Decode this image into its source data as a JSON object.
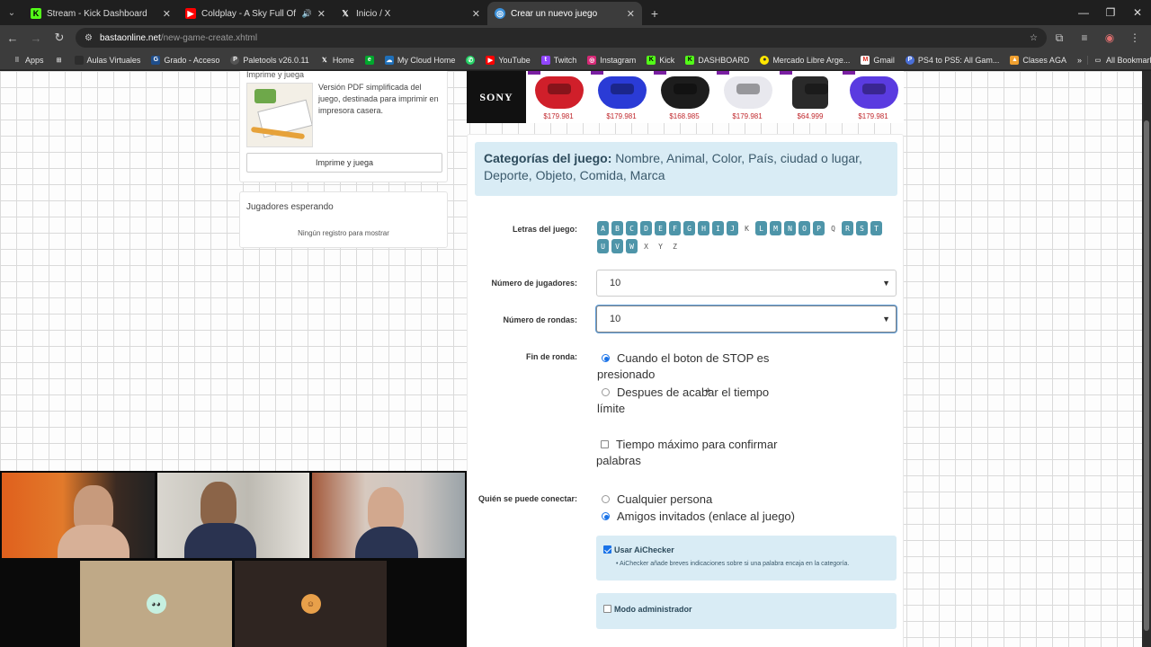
{
  "browser": {
    "tabs": [
      {
        "title": "Stream - Kick Dashboard",
        "icon": "kick-icon"
      },
      {
        "title": "Coldplay - A Sky Full Of Sta",
        "icon": "youtube-icon"
      },
      {
        "title": "Inicio / X",
        "icon": "x-icon"
      },
      {
        "title": "Crear un nuevo juego",
        "icon": "globe-icon",
        "active": true
      }
    ],
    "url_domain": "bastaonline.net",
    "url_path": "/new-game-create.xhtml",
    "bookmarks": [
      {
        "label": "Apps",
        "icon": "apps-grid-icon"
      },
      {
        "label": "",
        "icon": "tab-groups-icon"
      },
      {
        "label": "Aulas Virtuales",
        "icon": "aulas-icon"
      },
      {
        "label": "Grado - Acceso",
        "icon": "grado-icon"
      },
      {
        "label": "Paletools v26.0.11",
        "icon": "paletools-icon"
      },
      {
        "label": "Home",
        "icon": "x-icon"
      },
      {
        "label": "",
        "icon": "evernote-icon"
      },
      {
        "label": "My Cloud Home",
        "icon": "cloud-icon"
      },
      {
        "label": "",
        "icon": "whatsapp-icon"
      },
      {
        "label": "YouTube",
        "icon": "youtube-icon"
      },
      {
        "label": "Twitch",
        "icon": "twitch-icon"
      },
      {
        "label": "Instagram",
        "icon": "instagram-icon"
      },
      {
        "label": "Kick",
        "icon": "kick-icon"
      },
      {
        "label": "DASHBOARD",
        "icon": "kick-icon"
      },
      {
        "label": "Mercado Libre Arge...",
        "icon": "mercadolibre-icon"
      },
      {
        "label": "Gmail",
        "icon": "gmail-icon"
      },
      {
        "label": "PS4 to PS5: All Gam...",
        "icon": "ps-icon"
      },
      {
        "label": "Clases AGA",
        "icon": "aga-icon"
      }
    ],
    "all_bookmarks": "All Bookmarks"
  },
  "sidebar": {
    "print_title": "Imprime y juega",
    "print_description": "Versión PDF simplificada del juego, destinada para imprimir en impresora casera.",
    "print_button": "Imprime y juega",
    "waiting_title": "Jugadores esperando",
    "waiting_empty": "Ningún registro para mostrar"
  },
  "banner": {
    "brand": "SONY",
    "products": [
      {
        "price": "$179.981",
        "color": "#d01f2a"
      },
      {
        "price": "$179.981",
        "color": "#2a3bd6"
      },
      {
        "price": "$168.985",
        "color": "#1d1d1d"
      },
      {
        "price": "$179.981",
        "color": "#e8e8ee"
      },
      {
        "price": "$64.999",
        "color": "#2a2a2a"
      },
      {
        "price": "$179.981",
        "color": "#5a3be0"
      }
    ]
  },
  "form": {
    "categories_label": "Categorías del juego:",
    "categories_value": "Nombre, Animal, Color, País, ciudad o lugar, Deporte, Objeto, Comida, Marca",
    "letters_label": "Letras del juego:",
    "letters": [
      {
        "l": "A",
        "on": true
      },
      {
        "l": "B",
        "on": true
      },
      {
        "l": "C",
        "on": true
      },
      {
        "l": "D",
        "on": true
      },
      {
        "l": "E",
        "on": true
      },
      {
        "l": "F",
        "on": true
      },
      {
        "l": "G",
        "on": true
      },
      {
        "l": "H",
        "on": true
      },
      {
        "l": "I",
        "on": true
      },
      {
        "l": "J",
        "on": true
      },
      {
        "l": "K",
        "on": false
      },
      {
        "l": "L",
        "on": true
      },
      {
        "l": "M",
        "on": true
      },
      {
        "l": "N",
        "on": true
      },
      {
        "l": "O",
        "on": true
      },
      {
        "l": "P",
        "on": true
      },
      {
        "l": "Q",
        "on": false
      },
      {
        "l": "R",
        "on": true
      },
      {
        "l": "S",
        "on": true
      },
      {
        "l": "T",
        "on": true
      },
      {
        "l": "U",
        "on": true
      },
      {
        "l": "V",
        "on": true
      },
      {
        "l": "W",
        "on": true
      },
      {
        "l": "X",
        "on": false
      },
      {
        "l": "Y",
        "on": false
      },
      {
        "l": "Z",
        "on": false
      }
    ],
    "players_label": "Número de jugadores:",
    "players_value": "10",
    "rounds_label": "Número de rondas:",
    "rounds_value": "10",
    "round_end_label": "Fin de ronda:",
    "round_end_opt1": "Cuando el boton de STOP es presionado",
    "round_end_opt2": "Despues de acabar el tiempo límite",
    "max_time_label": "Tiempo máximo para confirmar palabras",
    "who_label": "Quién se puede conectar:",
    "who_opt1": "Cualquier persona",
    "who_opt2": "Amigos invitados (enlace al juego)",
    "aichecker_label": "Usar AiChecker",
    "aichecker_hint": "AiChecker añade breves indicaciones sobre si una palabra encaja en la categoría.",
    "admin_label": "Modo administrador"
  }
}
